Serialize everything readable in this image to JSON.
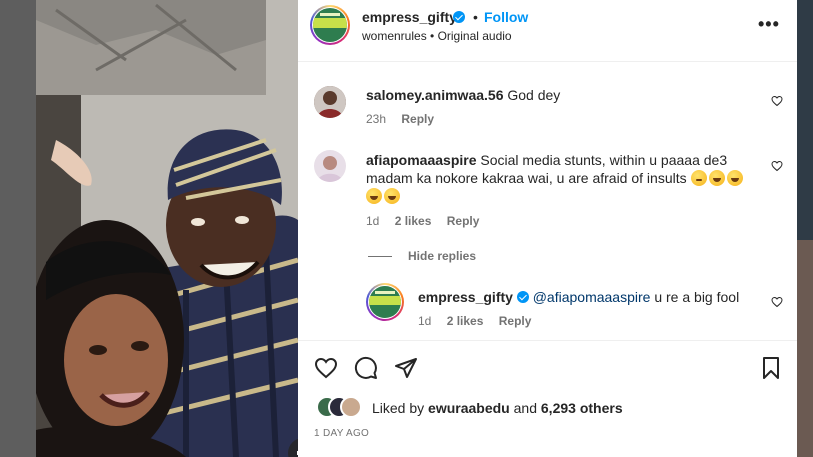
{
  "header": {
    "username": "empress_gifty",
    "separator": "•",
    "follow_label": "Follow",
    "subtitle": "womenrules • Original audio"
  },
  "comments": [
    {
      "username": "salomey.animwaa.56",
      "text": "God dey",
      "time": "23h",
      "reply_label": "Reply"
    },
    {
      "username": "afiapomaaaspire",
      "text_line1": "Social media stunts, within u paaaa de3",
      "text_line2": "madam ka nokore kakraa wai, u are afraid of insults",
      "time": "1d",
      "likes": "2 likes",
      "reply_label": "Reply"
    }
  ],
  "hide_replies_label": "Hide replies",
  "reply": {
    "username": "empress_gifty",
    "mention": "@afiapomaaaspire",
    "text": "u re a big fool",
    "time": "1d",
    "likes": "2 likes",
    "reply_label": "Reply"
  },
  "likes_summary": {
    "prefix": "Liked by ",
    "user": "ewuraabedu",
    "middle": " and ",
    "count": "6,293 others"
  },
  "date": "1 DAY AGO",
  "icons": {
    "verified": "verified-badge-icon",
    "more": "more-options-icon",
    "heart": "heart-icon",
    "comment": "comment-icon",
    "share": "share-icon",
    "save": "bookmark-icon",
    "mute": "muted-speaker-icon"
  },
  "colors": {
    "accent": "#0095f6",
    "text": "#262626",
    "secondary": "#737373",
    "mention": "#00376b"
  }
}
